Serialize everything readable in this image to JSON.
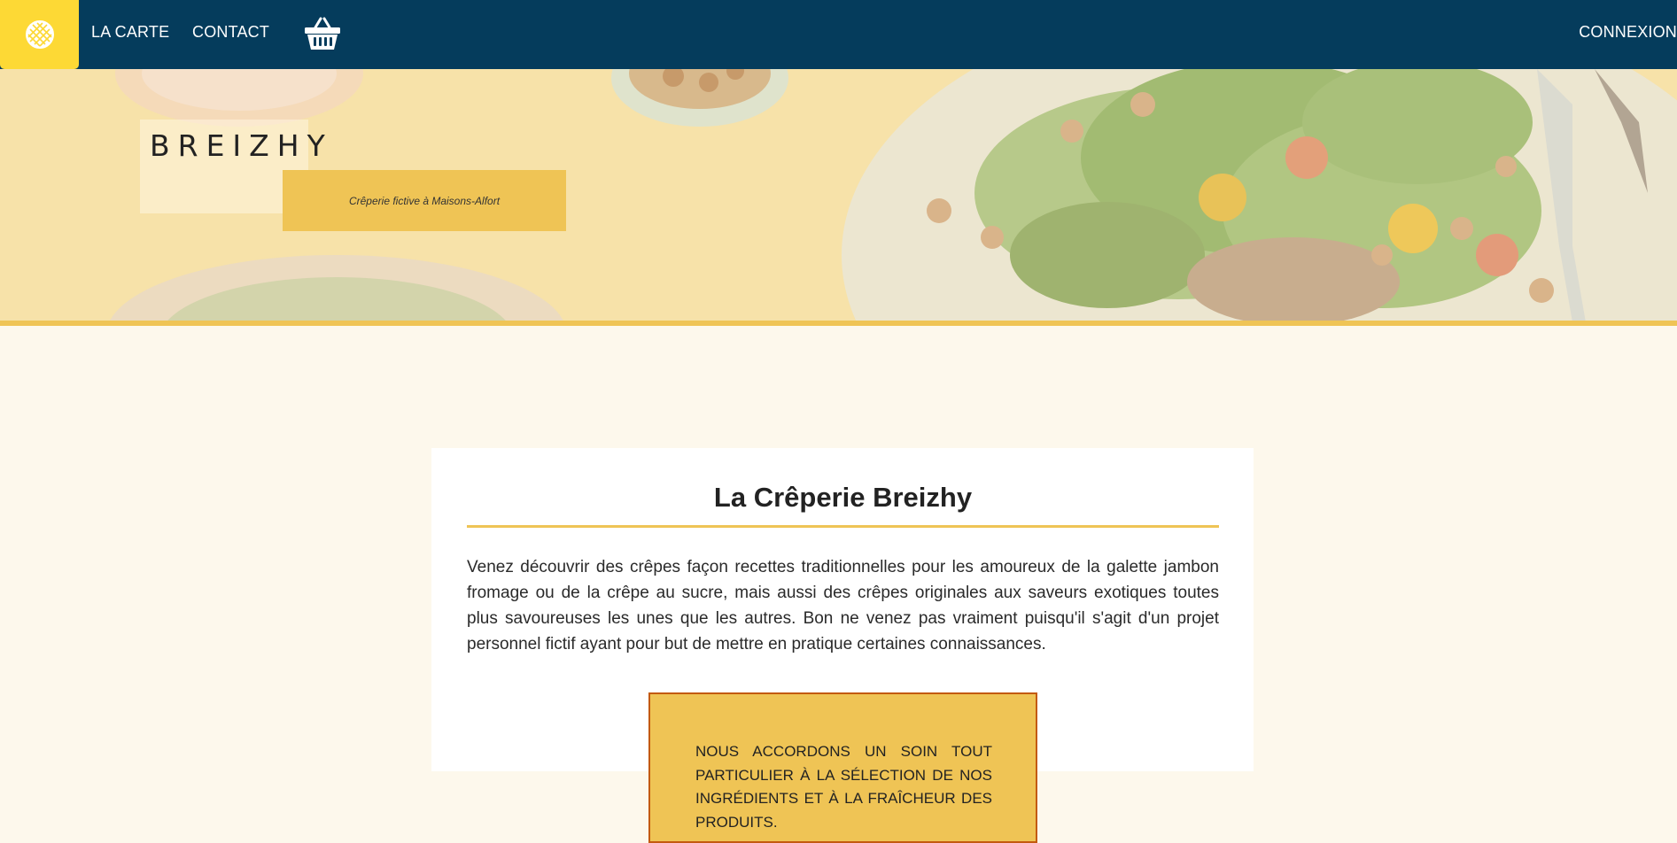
{
  "nav": {
    "links": [
      "LA CARTE",
      "CONTACT"
    ],
    "login_label": "CONNEXION",
    "logo_icon": "crepe-icon",
    "basket_icon": "basket-icon"
  },
  "hero": {
    "title": "BREIZHY",
    "subtitle": "Crêperie fictive à Maisons-Alfort"
  },
  "about": {
    "heading_prefix": "La Crêperie",
    "heading_bold": "Breizhy",
    "paragraph": "Venez découvrir des crêpes façon recettes traditionnelles pour les amoureux de la galette jambon fromage ou de la crêpe au sucre, mais aussi des crêpes originales aux saveurs exotiques toutes plus savoureuses les unes que les autres. Bon ne venez pas vraiment puisqu'il s'agit d'un projet personnel fictif ayant pour but de mettre en pratique certaines connaissances."
  },
  "highlight": {
    "text": "Nous accordons un soin tout particulier à la sélection de nos ingrédients et à la fraîcheur des produits."
  },
  "colors": {
    "navbar": "#053c5c",
    "logo_bg": "#fdd935",
    "accent": "#efc455",
    "highlight_border": "#c35a10",
    "page_bg": "#fdf8ec"
  }
}
